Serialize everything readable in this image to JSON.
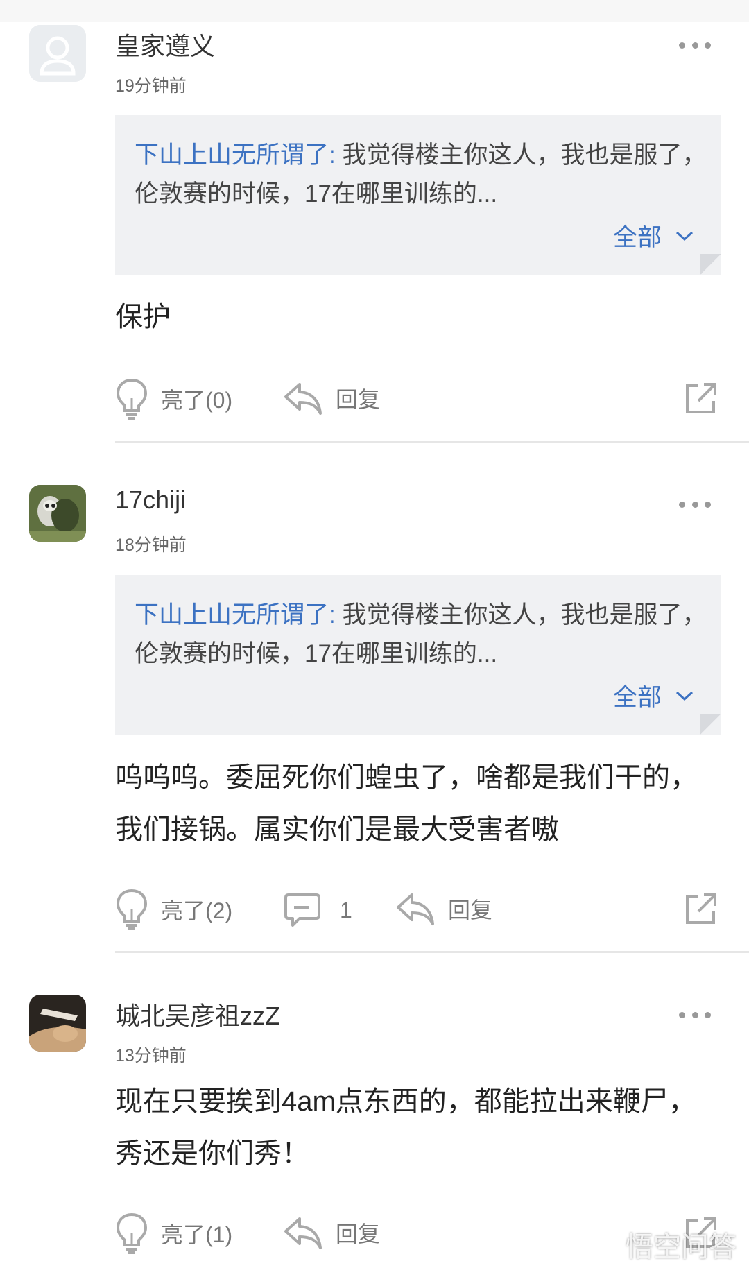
{
  "comments": [
    {
      "username": "皇家遵义",
      "time": "19分钟前",
      "quote": {
        "name": "下山上山无所谓了:",
        "text": " 我觉得楼主你这人，我也是服了，伦敦赛的时候，17在哪里训练的...",
        "more_label": "全部"
      },
      "body": "保护",
      "like_label": "亮了(0)",
      "reply_label": "回复"
    },
    {
      "username": "17chiji",
      "time": "18分钟前",
      "quote": {
        "name": "下山上山无所谓了:",
        "text": " 我觉得楼主你这人，我也是服了，伦敦赛的时候，17在哪里训练的...",
        "more_label": "全部"
      },
      "body": "呜呜呜。委屈死你们蝗虫了，啥都是我们干的，我们接锅。属实你们是最大受害者嗷",
      "like_label": "亮了(2)",
      "comment_count": "1",
      "reply_label": "回复"
    },
    {
      "username": "城北吴彦祖zzZ",
      "time": "13分钟前",
      "body": "现在只要挨到4am点东西的，都能拉出来鞭尸，秀还是你们秀！",
      "like_label": "亮了(1)",
      "reply_label": "回复"
    }
  ],
  "watermark": "悟空问答",
  "colors": {
    "link": "#3c72c2",
    "quote_bg": "#f0f1f3",
    "icon": "#a9a9a9"
  },
  "icons": [
    "more-icon",
    "lightbulb-icon",
    "reply-arrow-icon",
    "comment-bubble-icon",
    "share-icon",
    "chevron-down-icon",
    "user-icon"
  ]
}
